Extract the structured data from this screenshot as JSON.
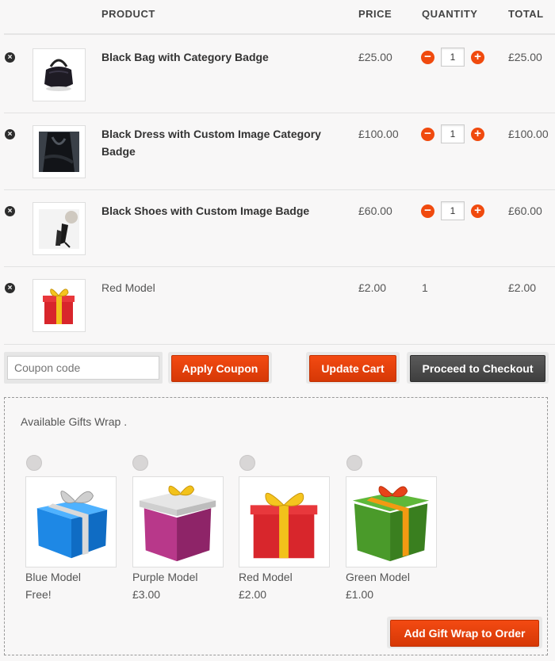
{
  "table": {
    "headers": {
      "product": "PRODUCT",
      "price": "PRICE",
      "quantity": "QUANTITY",
      "total": "TOTAL"
    },
    "rows": [
      {
        "name": "Black Bag with Category Badge",
        "price": "£25.00",
        "qty": "1",
        "total": "£25.00",
        "remove": "×",
        "image": "black-bag"
      },
      {
        "name": "Black Dress with Custom Image Category Badge",
        "price": "£100.00",
        "qty": "1",
        "total": "£100.00",
        "remove": "×",
        "image": "black-dress"
      },
      {
        "name": "Black Shoes with Custom Image Badge",
        "price": "£60.00",
        "qty": "1",
        "total": "£60.00",
        "remove": "×",
        "image": "black-shoes"
      },
      {
        "name": "Red Model",
        "price": "£2.00",
        "qty": "1",
        "total": "£2.00",
        "remove": "×",
        "image": "red-gift"
      }
    ]
  },
  "qty_controls": {
    "minus": "−",
    "plus": "+"
  },
  "actions": {
    "coupon_placeholder": "Coupon code",
    "apply_coupon": "Apply Coupon",
    "update_cart": "Update Cart",
    "checkout": "Proceed to Checkout"
  },
  "gifts": {
    "title": "Available Gifts Wrap .",
    "items": [
      {
        "name": "Blue Model",
        "price": "Free!",
        "color": "#1e88e5"
      },
      {
        "name": "Purple Model",
        "price": "£3.00",
        "color": "#a8307a"
      },
      {
        "name": "Red Model",
        "price": "£2.00",
        "color": "#d8262c"
      },
      {
        "name": "Green Model",
        "price": "£1.00",
        "color": "#4a9a2a"
      }
    ],
    "add_button": "Add Gift Wrap to Order"
  },
  "colors": {
    "accent": "#f04a0e",
    "dark_button": "#444444"
  }
}
